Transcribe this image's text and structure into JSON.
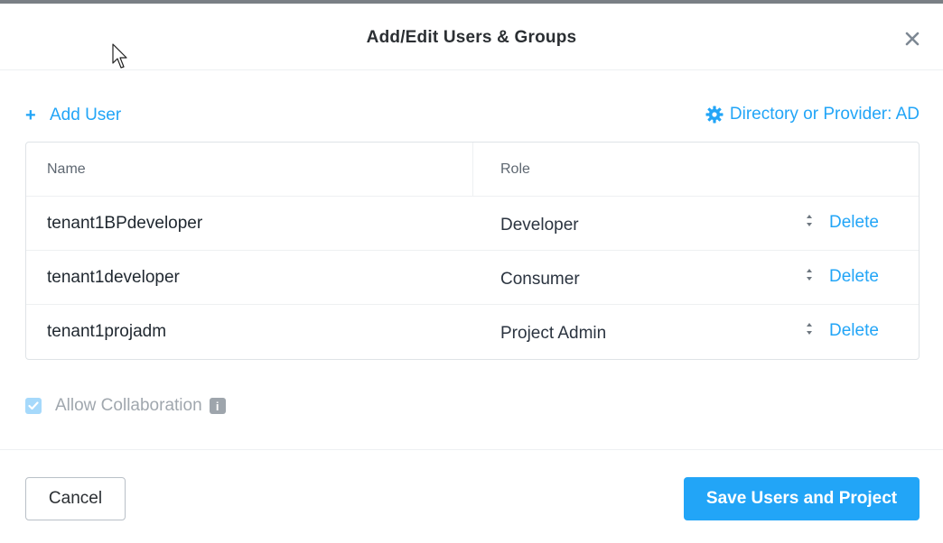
{
  "dialog": {
    "title": "Add/Edit Users & Groups",
    "close_icon": "close-icon"
  },
  "toolbar": {
    "add_user_icon": "plus-icon",
    "add_user_label": "Add User",
    "directory_icon": "gear-icon",
    "directory_label": "Directory or Provider: AD"
  },
  "table": {
    "columns": [
      "Name",
      "Role"
    ],
    "rows": [
      {
        "name": "tenant1BPdeveloper",
        "role": "Developer",
        "action": "Delete"
      },
      {
        "name": "tenant1developer",
        "role": "Consumer",
        "action": "Delete"
      },
      {
        "name": "tenant1projadm",
        "role": "Project Admin",
        "action": "Delete"
      }
    ]
  },
  "collaboration": {
    "label": "Allow Collaboration",
    "checked": true,
    "info_glyph": "i"
  },
  "footer": {
    "cancel_label": "Cancel",
    "save_label": "Save Users and Project"
  },
  "colors": {
    "accent": "#22a5f7",
    "text": "#2b3440",
    "muted": "#a0a7ae",
    "border": "#dfe3e7"
  }
}
